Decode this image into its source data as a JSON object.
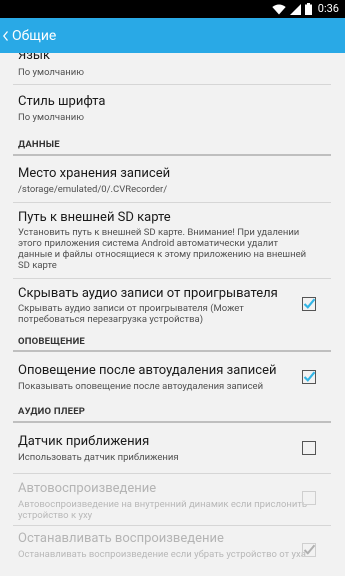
{
  "status_bar": {
    "time": "0:36",
    "icons": [
      "wifi-icon",
      "signal-icon",
      "battery-icon"
    ]
  },
  "action_bar": {
    "title": "Общие",
    "back_icon": "chevron-left-icon",
    "color": "#29a9e6"
  },
  "preferences": [
    {
      "title": "Язык",
      "summary": "По умолчанию"
    },
    {
      "title": "Стиль шрифта",
      "summary": "По умолчанию"
    }
  ],
  "sections": [
    {
      "header": "ДАННЫЕ",
      "items": [
        {
          "title": "Место хранения записей",
          "summary": "/storage/emulated/0/.CVRecorder/"
        },
        {
          "title": "Путь к внешней SD карте",
          "summary": "Установить путь к внешней SD карте. Внимание! При удалении этого приложения система Android автоматически удалит данные и файлы относящиеся к этому приложению на внешней SD карте"
        },
        {
          "title": "Скрывать аудио записи от проигрывателя",
          "summary": "Скрывать аудио записи от проигрывателя (Может потребоваться перезагрузка устройства)",
          "checked": true
        }
      ]
    },
    {
      "header": "ОПОВЕЩЕНИЕ",
      "items": [
        {
          "title": "Оповещение после автоудаления записей",
          "summary": "Показывать оповещение после автоудаления записей",
          "checked": true
        }
      ]
    },
    {
      "header": "АУДИО ПЛЕЕР",
      "items": [
        {
          "title": "Датчик приближения",
          "summary": "Использовать датчик приближения",
          "checked": false
        },
        {
          "title": "Автовоспроизведение",
          "summary": "Автовоспроизведение на внутренний динамик если прислонить устройство к уху",
          "checked": false,
          "enabled": false
        },
        {
          "title": "Останавливать воспроизведение",
          "summary": "Останавливать воспроизведение если убрать устройство от уха",
          "checked": true,
          "enabled": false
        }
      ]
    }
  ],
  "colors": {
    "accent": "#29a9e6",
    "checkbox_on": "#33b5e5",
    "background": "#f2f2f2"
  }
}
